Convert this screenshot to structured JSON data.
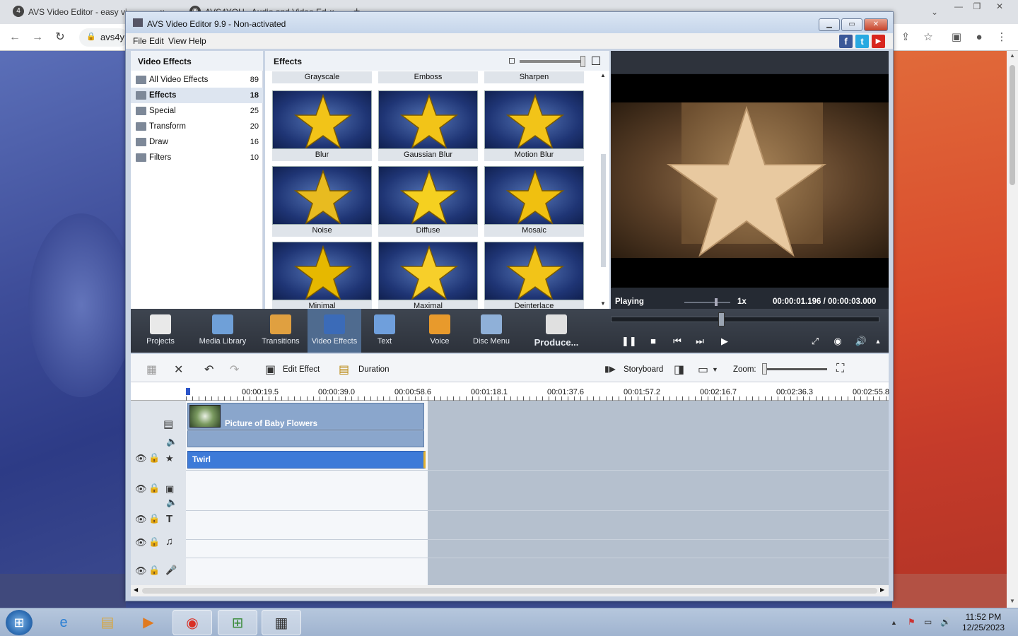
{
  "browser": {
    "tabs": [
      {
        "title": "AVS Video Editor - easy vi",
        "close": "×"
      },
      {
        "title": "AVS4YOU - Audio and Video Ed",
        "close": "×"
      }
    ],
    "new_tab": "+",
    "url": "avs4y",
    "window_controls": [
      "—",
      "❐",
      "✕"
    ],
    "tab_dropdown": "⌄",
    "nav": {
      "back": "←",
      "forward": "→",
      "reload": "↻"
    },
    "ext_icons": [
      "⇪",
      "☆",
      "▣",
      "●",
      "⋮"
    ]
  },
  "app": {
    "title": "AVS Video Editor 9.9 - Non-activated",
    "menu": [
      "File",
      "Edit",
      "View",
      "Help"
    ],
    "title_buttons": {
      "minimize": "▁",
      "maximize": "▭",
      "close": "✕"
    },
    "social": {
      "facebook": "f",
      "twitter": "t",
      "youtube": "▶"
    }
  },
  "categories": {
    "header": "Video Effects",
    "items": [
      {
        "label": "All Video Effects",
        "count": "89",
        "selected": false
      },
      {
        "label": "Effects",
        "count": "18",
        "selected": true
      },
      {
        "label": "Special",
        "count": "25",
        "selected": false
      },
      {
        "label": "Transform",
        "count": "20",
        "selected": false
      },
      {
        "label": "Draw",
        "count": "16",
        "selected": false
      },
      {
        "label": "Filters",
        "count": "10",
        "selected": false
      }
    ]
  },
  "effects": {
    "header": "Effects",
    "top_row": [
      "Grayscale",
      "Emboss",
      "Sharpen"
    ],
    "tiles": [
      "Blur",
      "Gaussian Blur",
      "Motion Blur",
      "Noise",
      "Diffuse",
      "Mosaic",
      "Minimal",
      "Maximal",
      "Deinterlace"
    ]
  },
  "preview": {
    "status": "Playing",
    "speed": "1x",
    "time": "00:00:01.196  /  00:00:03.000",
    "controls": {
      "pause": "❚❚",
      "stop": "■",
      "prev": "⏮",
      "next": "⏭",
      "play_to": "▶"
    },
    "right_controls": {
      "fullscreen": "⤢",
      "snapshot": "◉",
      "volume": "🔊",
      "more": "▲"
    }
  },
  "toolbar": [
    {
      "label": "Projects",
      "icon": "clapper-icon",
      "color": "#e9e9e9"
    },
    {
      "label": "Media Library",
      "icon": "film-icon",
      "color": "#6fa0d8"
    },
    {
      "label": "Transitions",
      "icon": "transitions-icon",
      "color": "#e0a040"
    },
    {
      "label": "Video Effects",
      "icon": "star-icon",
      "color": "#3b6bb8",
      "selected": true
    },
    {
      "label": "Text",
      "icon": "text-icon",
      "color": "#6f9fdc"
    },
    {
      "label": "Voice",
      "icon": "microphone-icon",
      "color": "#e89a2c"
    },
    {
      "label": "Disc Menu",
      "icon": "disc-icon",
      "color": "#8fb0d8"
    },
    {
      "label": "Produce...",
      "icon": "produce-icon",
      "color": "#e0e0e0"
    }
  ],
  "timeline_toolbar": {
    "edit_effect": "Edit Effect",
    "duration": "Duration",
    "storyboard": "Storyboard",
    "zoom": "Zoom:",
    "icons": {
      "grid": "▦",
      "delete": "✕",
      "undo": "↶",
      "redo": "↷",
      "edit": "▣",
      "duration": "▤",
      "storyboard": "▮▶",
      "audio": "◨",
      "view": "▭",
      "fit": "⛶"
    }
  },
  "timeline": {
    "ticks": [
      "00:00:19.5",
      "00:00:39.0",
      "00:00:58.6",
      "00:01:18.1",
      "00:01:37.6",
      "00:01:57.2",
      "00:02:16.7",
      "00:02:36.3",
      "00:02:55.8"
    ],
    "video_clip": "Picture of Baby Flowers",
    "effect_clip": "Twirl",
    "track_icons": {
      "eye": "👁",
      "lock": "🔒",
      "film": "▤",
      "mute": "🔈",
      "star": "★",
      "overlay": "▣",
      "text": "T",
      "music": "♫",
      "mic": "🎤"
    }
  },
  "taskbar": {
    "time": "11:52 PM",
    "date": "12/25/2023",
    "tray": [
      "▲",
      "⚑",
      "▭",
      "🔊"
    ]
  }
}
